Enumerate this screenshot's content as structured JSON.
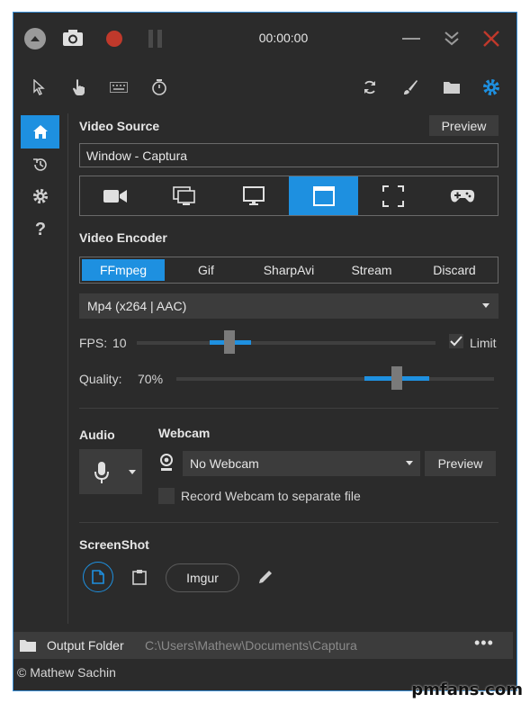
{
  "titlebar": {
    "timer": "00:00:00"
  },
  "video_source": {
    "heading": "Video Source",
    "preview_label": "Preview",
    "value": "Window  -  Captura",
    "source_types": [
      "camera",
      "screen",
      "monitor",
      "window",
      "region",
      "game"
    ],
    "selected_index": 3
  },
  "video_encoder": {
    "heading": "Video Encoder",
    "tabs": [
      "FFmpeg",
      "Gif",
      "SharpAvi",
      "Stream",
      "Discard"
    ],
    "selected_tab": 0,
    "codec": "Mp4 (x264 | AAC)"
  },
  "fps": {
    "label": "FPS:",
    "value": "10",
    "limit_label": "Limit",
    "limit_checked": true,
    "level": 0.3
  },
  "quality": {
    "label": "Quality:",
    "value": "70%",
    "level": 0.7
  },
  "audio": {
    "heading": "Audio"
  },
  "webcam": {
    "heading": "Webcam",
    "selected": "No Webcam",
    "preview_label": "Preview",
    "separate_file_label": "Record Webcam to separate file"
  },
  "screenshot": {
    "heading": "ScreenShot",
    "imgur_label": "Imgur"
  },
  "output": {
    "label": "Output Folder",
    "path": "C:\\Users\\Mathew\\Documents\\Captura"
  },
  "footer": {
    "copyright": "© Mathew Sachin"
  },
  "watermark": "pmfans.com",
  "colors": {
    "accent": "#1e90e0",
    "background": "#2b2b2b",
    "close": "#c0392b",
    "record": "#c0392b"
  }
}
